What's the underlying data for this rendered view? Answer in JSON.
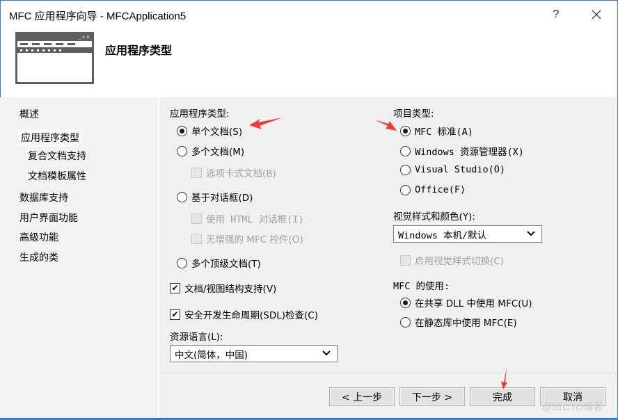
{
  "window": {
    "title": "MFC 应用程序向导 - MFCApplication5",
    "help_label": "?",
    "close_label": "✕",
    "accent_color": "#2b7fd1"
  },
  "header": {
    "heading": "应用程序类型",
    "icon": "window-template-icon"
  },
  "sidebar": {
    "items": [
      {
        "label": "概述",
        "selected": false,
        "indent": false
      },
      {
        "label": "应用程序类型",
        "selected": true,
        "indent": false
      },
      {
        "label": "复合文档支持",
        "selected": false,
        "indent": true
      },
      {
        "label": "文档模板属性",
        "selected": false,
        "indent": true
      },
      {
        "label": "数据库支持",
        "selected": false,
        "indent": false
      },
      {
        "label": "用户界面功能",
        "selected": false,
        "indent": false
      },
      {
        "label": "高级功能",
        "selected": false,
        "indent": false
      },
      {
        "label": "生成的类",
        "selected": false,
        "indent": false
      }
    ]
  },
  "app_type": {
    "label": "应用程序类型:",
    "options": [
      {
        "label": "单个文档(S)",
        "checked": true
      },
      {
        "label": "多个文档(M)",
        "checked": false
      },
      {
        "label": "基于对话框(D)",
        "checked": false
      },
      {
        "label": "多个顶级文档(T)",
        "checked": false
      }
    ],
    "tabbed_docs": {
      "label": "选项卡式文档(B)",
      "checked": false,
      "enabled": false
    },
    "html_dialog": {
      "label": "使用 HTML 对话框(I)",
      "checked": false,
      "enabled": false
    },
    "no_enhanced": {
      "label": "无增强的 MFC 控件(O)",
      "checked": false,
      "enabled": false
    },
    "doc_view": {
      "label": "文档/视图结构支持(V)",
      "checked": true
    },
    "sdl": {
      "label": "安全开发生命周期(SDL)检查(C)",
      "checked": true
    },
    "resource_language": {
      "label": "资源语言(L):",
      "value": "中文(简体，中国)"
    }
  },
  "project_type": {
    "label": "项目类型:",
    "options": [
      {
        "label": "MFC 标准(A)",
        "checked": true
      },
      {
        "label": "Windows 资源管理器(X)",
        "checked": false
      },
      {
        "label": "Visual Studio(O)",
        "checked": false
      },
      {
        "label": "Office(F)",
        "checked": false
      }
    ],
    "visual_style": {
      "label": "视觉样式和颜色(Y):",
      "value": "Windows 本机/默认"
    },
    "style_switch": {
      "label": "启用视觉样式切换(C)",
      "checked": false,
      "enabled": false
    }
  },
  "mfc_use": {
    "label": "MFC 的使用:",
    "options": [
      {
        "label": "在共享 DLL 中使用 MFC(U)",
        "checked": true
      },
      {
        "label": "在静态库中使用 MFC(E)",
        "checked": false
      }
    ]
  },
  "footer": {
    "back_label": "< 上一步",
    "next_label": "下一步 >",
    "finish_label": "完成",
    "cancel_label": "取消"
  },
  "annotations": {
    "arrow_color": "#f03a3a"
  },
  "watermark": "@51CTO博客"
}
